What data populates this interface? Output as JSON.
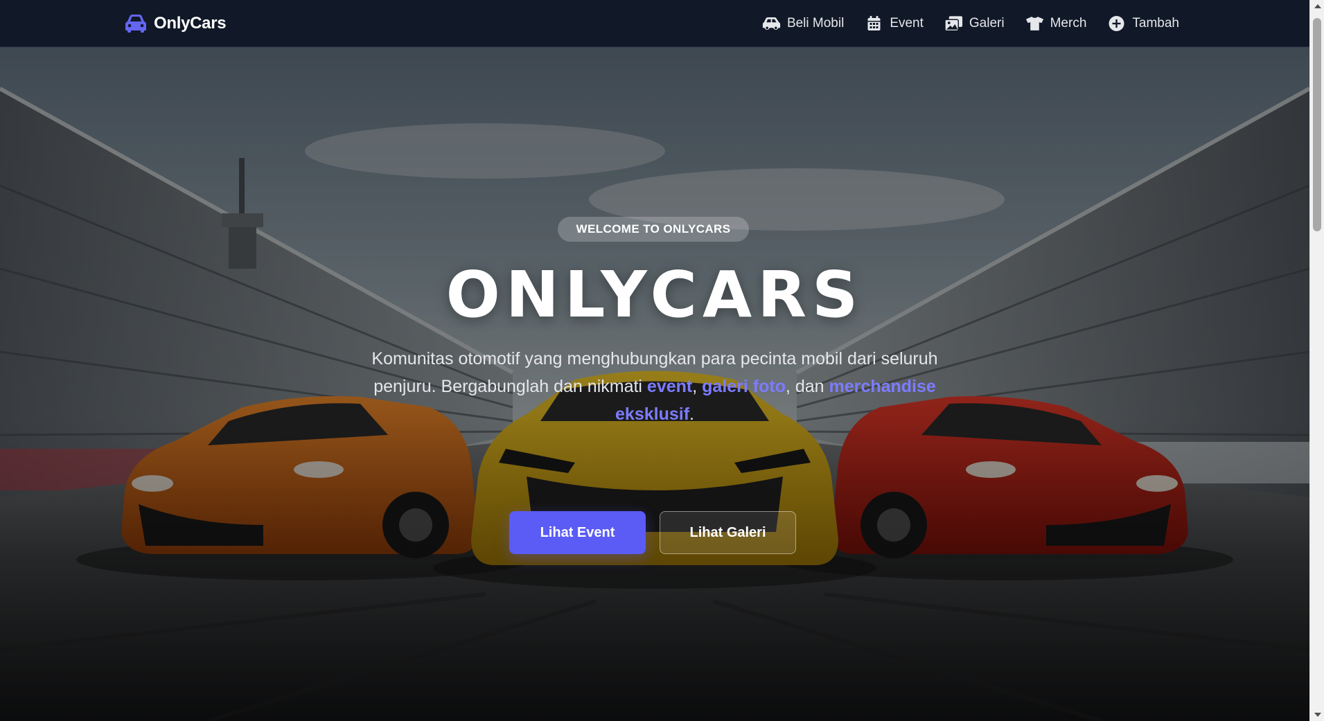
{
  "brand": {
    "name": "OnlyCars",
    "icon": "car-icon",
    "accent": "#5b5bf6"
  },
  "nav": {
    "items": [
      {
        "label": "Beli Mobil",
        "icon": "car-side-icon"
      },
      {
        "label": "Event",
        "icon": "calendar-icon"
      },
      {
        "label": "Galeri",
        "icon": "images-icon"
      },
      {
        "label": "Merch",
        "icon": "shirt-icon"
      },
      {
        "label": "Tambah",
        "icon": "plus-circle-icon"
      }
    ]
  },
  "hero": {
    "badge": "WELCOME TO ONLYCARS",
    "title": "ONLYCARS",
    "desc_part1": "Komunitas otomotif yang menghubungkan para pecinta mobil dari seluruh penjuru. Bergabunglah dan nikmati ",
    "desc_hl1": "event",
    "desc_sep1": ", ",
    "desc_hl2": "galeri foto",
    "desc_sep2": ", dan ",
    "desc_hl3": "merchandise eksklusif",
    "desc_end": ".",
    "primary_button": "Lihat Event",
    "secondary_button": "Lihat Galeri"
  },
  "colors": {
    "navbar": "#111827",
    "highlight": "#7c7cff",
    "primary_button": "#5b5bf6"
  }
}
